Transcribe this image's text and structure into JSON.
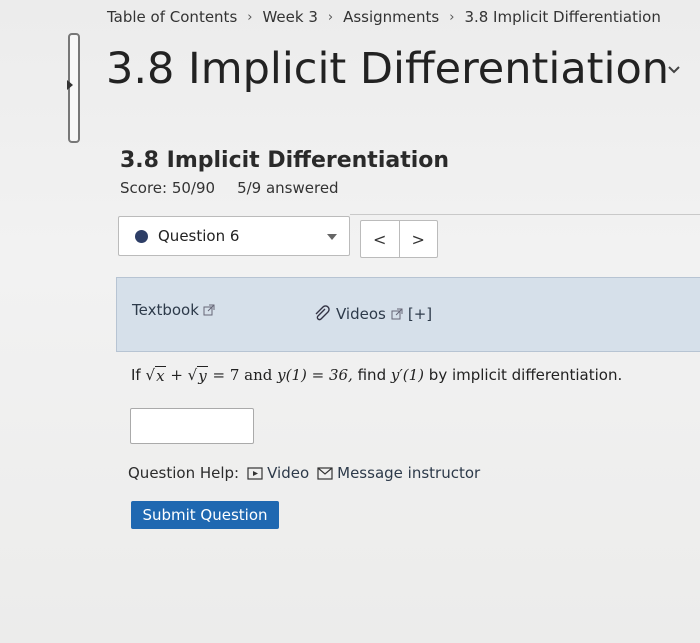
{
  "breadcrumb": {
    "items": [
      "Table of Contents",
      "Week 3",
      "Assignments",
      "3.8 Implicit Differentiation"
    ],
    "separator": "›"
  },
  "page": {
    "title": "3.8 Implicit Differentiation"
  },
  "assignment": {
    "title": "3.8 Implicit Differentiation",
    "score": "Score: 50/90",
    "answered": "5/9 answered"
  },
  "question_select": {
    "selected": "Question 6",
    "prev_label": "<",
    "next_label": ">"
  },
  "resources": {
    "textbook": "Textbook",
    "videos": "Videos",
    "expand": "[+]"
  },
  "question": {
    "prefix": "If",
    "x_var": "x",
    "plus": "+",
    "y_var": "y",
    "eq": "= 7 and",
    "cond": "y(1) = 36,",
    "tail": "find",
    "deriv": "y′(1)",
    "suffix": "by implicit differentiation.",
    "answer_value": ""
  },
  "help": {
    "label": "Question Help:",
    "video": "Video",
    "message": "Message instructor"
  },
  "submit": {
    "label": "Submit Question"
  },
  "colors": {
    "accent": "#1f68b1",
    "resource_bg": "#d6e0ea",
    "dot": "#2d3e66"
  }
}
